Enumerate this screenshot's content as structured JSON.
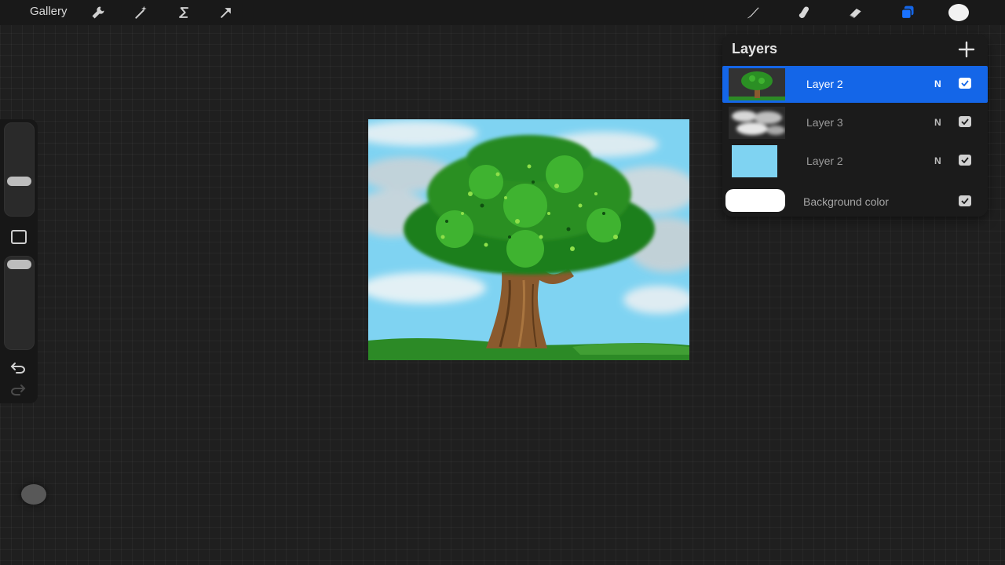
{
  "toolbar": {
    "gallery_label": "Gallery",
    "left_tools": [
      {
        "name": "actions",
        "icon": "wrench-icon"
      },
      {
        "name": "adjustments",
        "icon": "magic-wand-icon"
      },
      {
        "name": "selection",
        "icon": "selection-s-icon"
      },
      {
        "name": "transform",
        "icon": "arrow-cursor-icon"
      }
    ],
    "right_tools": [
      {
        "name": "brush",
        "icon": "brush-icon"
      },
      {
        "name": "smudge",
        "icon": "smudge-finger-icon"
      },
      {
        "name": "eraser",
        "icon": "eraser-icon"
      },
      {
        "name": "layers",
        "icon": "layers-icon",
        "active": true
      },
      {
        "name": "color",
        "icon": "color-swatch-icon",
        "color": "#f2f2f2"
      }
    ],
    "accent_color": "#1466e8"
  },
  "sidebar": {
    "brush_size_level": 0.3,
    "opacity_level": 0.05,
    "undo_icon": "undo-icon",
    "redo_icon": "redo-icon",
    "modify_icon": "square-modify-icon"
  },
  "layers_panel": {
    "title": "Layers",
    "add_icon": "plus-icon",
    "layers": [
      {
        "name": "Layer 2",
        "blend": "N",
        "visible": true,
        "selected": true,
        "thumb": "tree"
      },
      {
        "name": "Layer 3",
        "blend": "N",
        "visible": true,
        "selected": false,
        "thumb": "clouds"
      },
      {
        "name": "Layer 2",
        "blend": "N",
        "visible": true,
        "selected": false,
        "thumb": "sky"
      }
    ],
    "background": {
      "name": "Background color",
      "color": "#ffffff",
      "visible": true
    }
  },
  "canvas": {
    "sky_color": "#7fd3f2",
    "foliage_color": "#2f9e2c",
    "trunk_color": "#8a5a2e",
    "grass_color": "#2c8a26"
  }
}
